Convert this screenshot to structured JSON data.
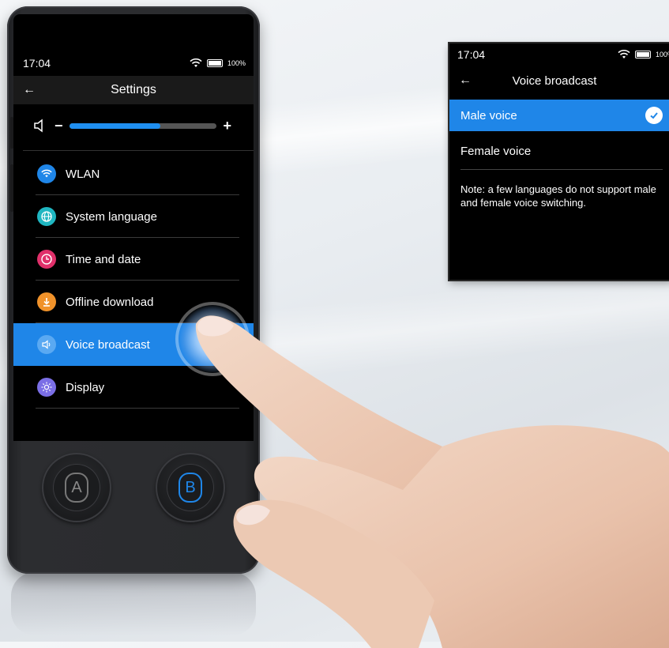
{
  "device": {
    "status": {
      "time": "17:04",
      "battery": "100%"
    },
    "title": "Settings",
    "volume": {
      "minus": "−",
      "plus": "+",
      "level": 0.62
    },
    "menu": [
      {
        "label": "WLAN",
        "icon": "wifi-icon",
        "color": "#1f86e8"
      },
      {
        "label": "System language",
        "icon": "globe-icon",
        "color": "#1fb6c1"
      },
      {
        "label": "Time and date",
        "icon": "clock-icon",
        "color": "#e0306a"
      },
      {
        "label": "Offline download",
        "icon": "download-icon",
        "color": "#f0922a"
      },
      {
        "label": "Voice broadcast",
        "icon": "speaker-icon",
        "color": "#5aa9f2",
        "active": true
      },
      {
        "label": "Display",
        "icon": "brightness-icon",
        "color": "#7b6fe6"
      }
    ],
    "buttons": {
      "a": "A",
      "b": "B"
    }
  },
  "popup": {
    "status": {
      "time": "17:04",
      "battery": "100%"
    },
    "title": "Voice broadcast",
    "options": [
      {
        "label": "Male voice",
        "selected": true
      },
      {
        "label": "Female voice",
        "selected": false
      }
    ],
    "note": "Note: a few languages do not support male and female voice switching."
  },
  "colors": {
    "accent": "#1f86e8",
    "screen_bg": "#000000",
    "device_body": "#2a2b2e"
  }
}
